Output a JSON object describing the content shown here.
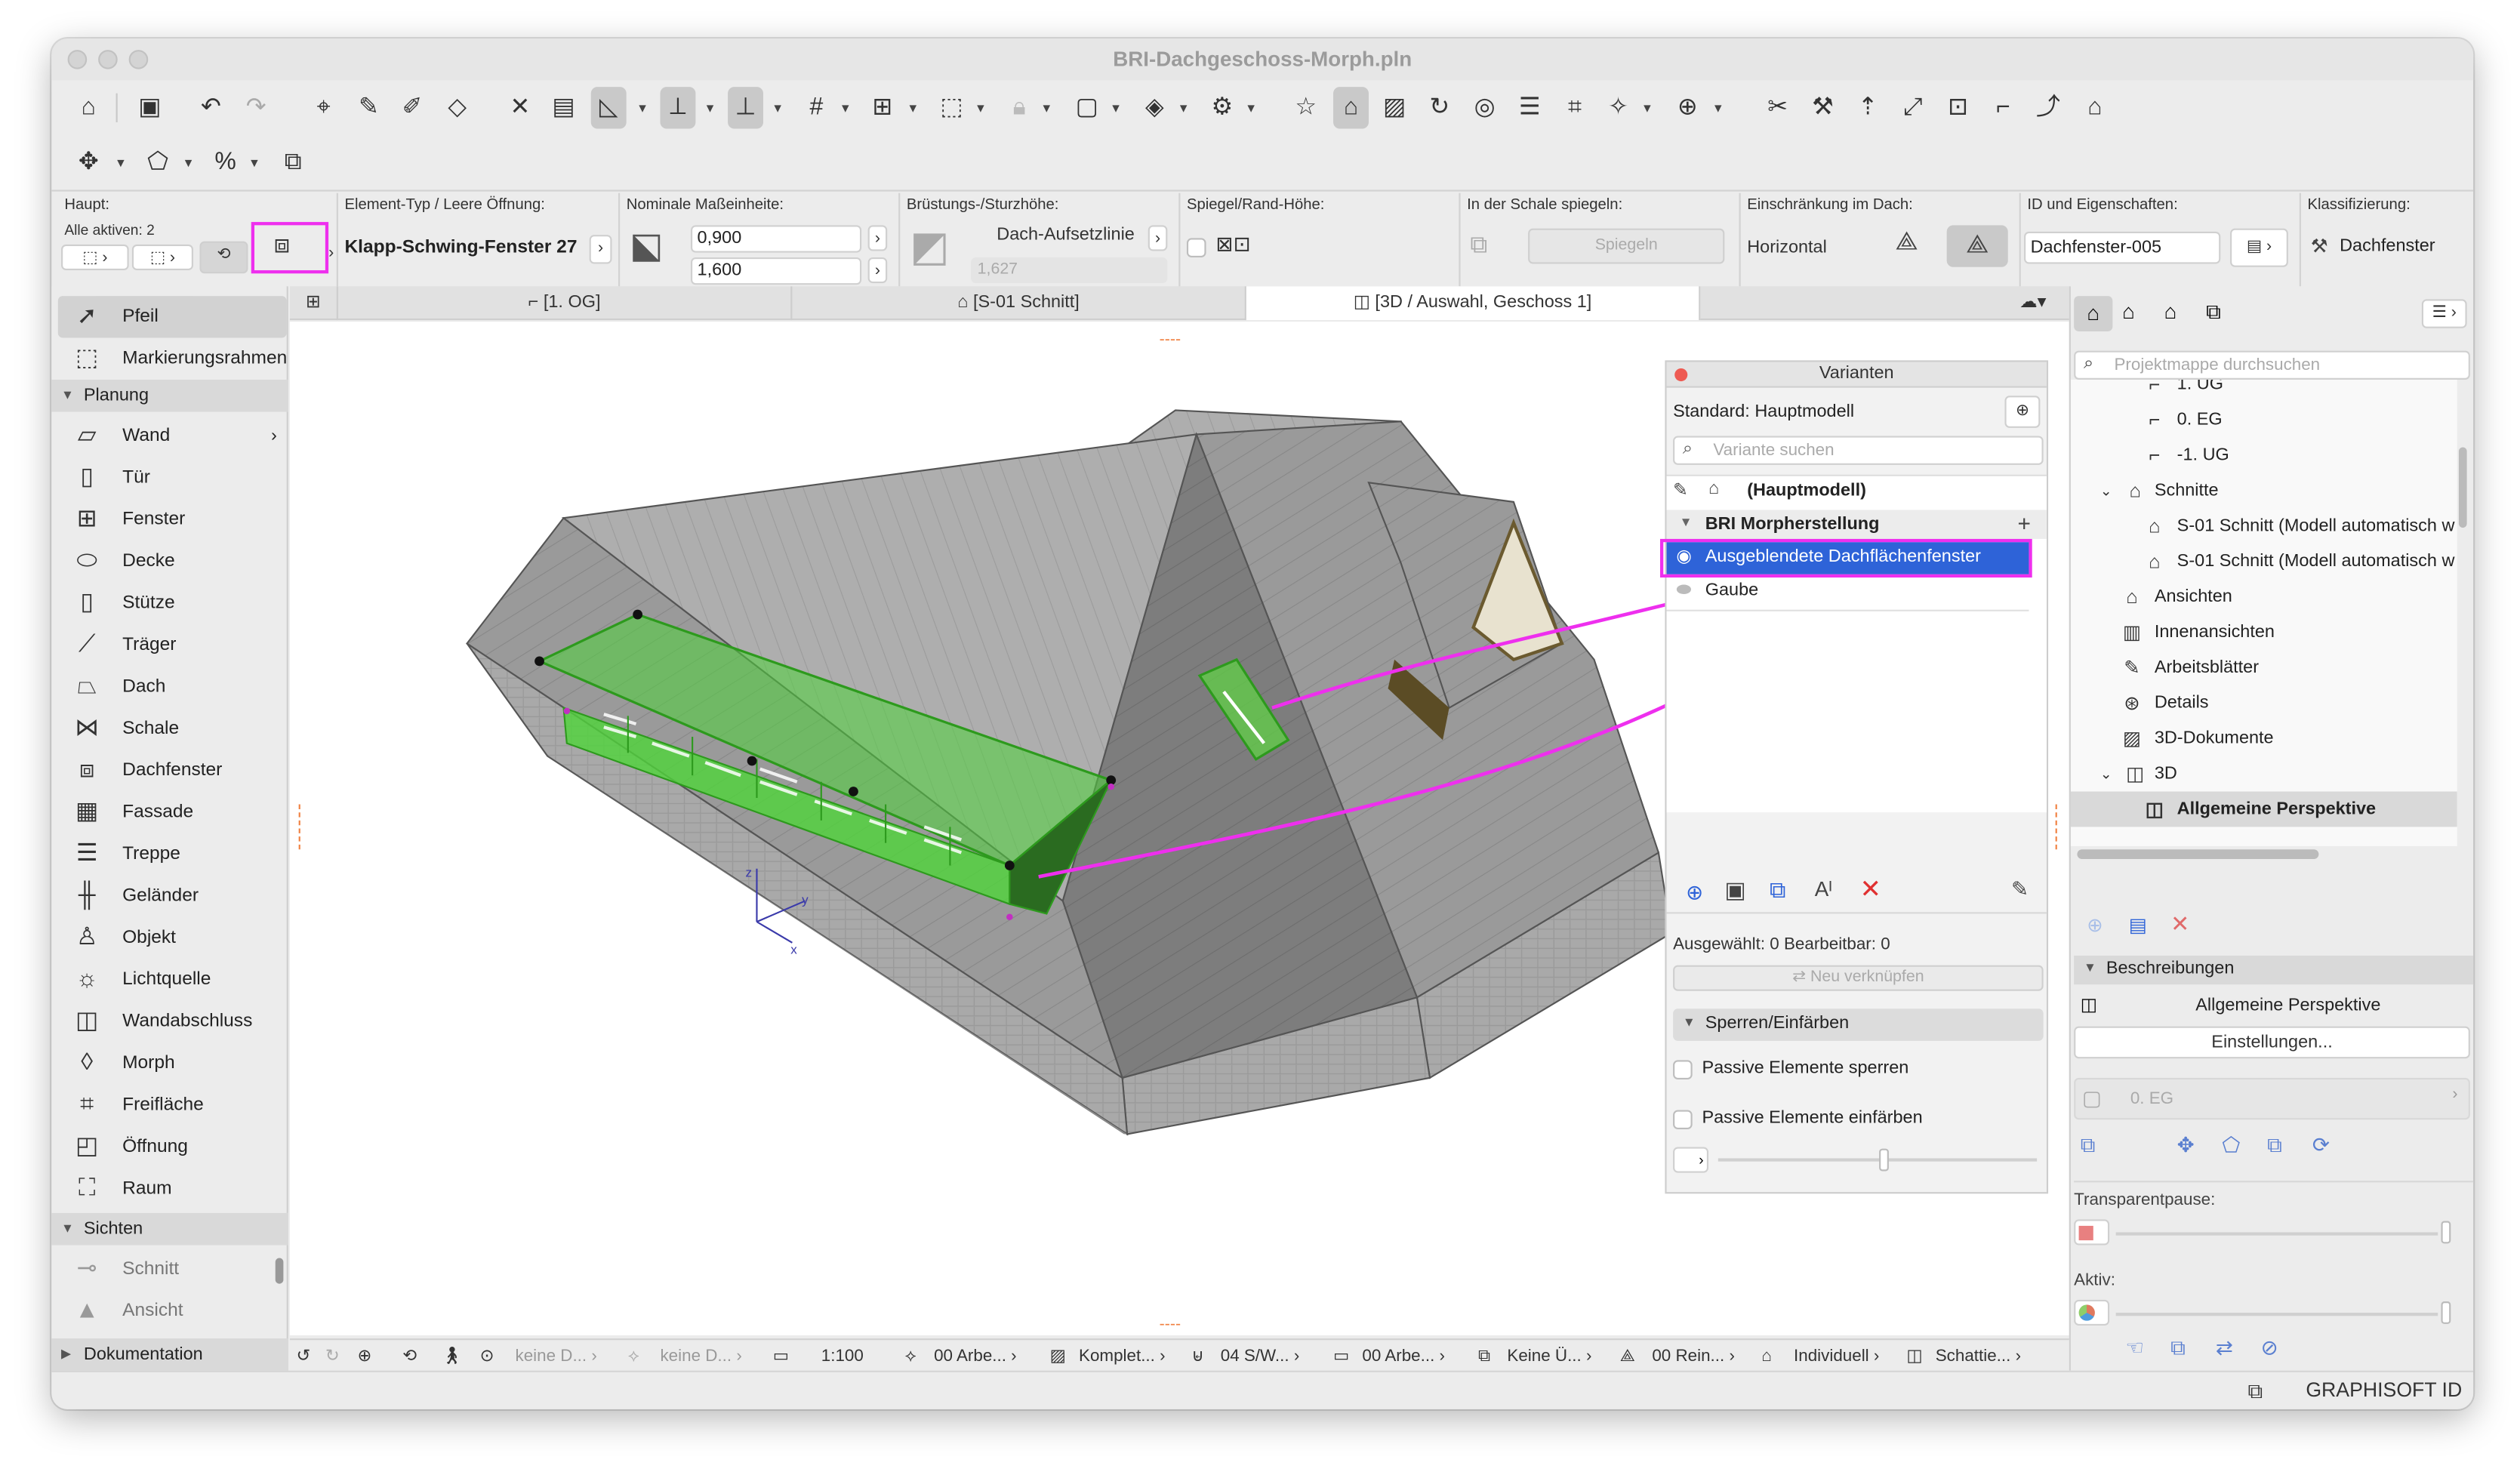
{
  "window": {
    "title": "BRI-Dachgeschoss-Morph.pln"
  },
  "info_box": {
    "haupt_label": "Haupt:",
    "alle_aktiven": "Alle aktiven: 2",
    "element_typ_label": "Element-Typ / Leere Öffnung:",
    "element_typ_value": "Klapp-Schwing-Fenster 27",
    "masseinheit_label": "Nominale Maßeinheite:",
    "width_value": "0,900",
    "height_value": "1,600",
    "bruestung_label": "Brüstungs-/Sturzhöhe:",
    "bruestung_value": "Dach-Aufsetzlinie",
    "bruestung_num": "1,627",
    "spiegel_label": "Spiegel/Rand-Höhe:",
    "schale_label": "In der Schale spiegeln:",
    "spiegeln_button": "Spiegeln",
    "einschraenkung_label": "Einschränkung im Dach:",
    "einschraenkung_value": "Horizontal",
    "id_label": "ID und Eigenschaften:",
    "id_value": "Dachfenster-005",
    "klass_label": "Klassifizierung:",
    "klass_value": "Dachfenster"
  },
  "toolbox": {
    "pfeil": "Pfeil",
    "markierungsrahmen": "Markierungsrahmen",
    "planung_header": "Planung",
    "planung_items": [
      "Wand",
      "Tür",
      "Fenster",
      "Decke",
      "Stütze",
      "Träger",
      "Dach",
      "Schale",
      "Dachfenster",
      "Fassade",
      "Treppe",
      "Geländer",
      "Objekt",
      "Lichtquelle",
      "Wandabschluss",
      "Morph",
      "Freifläche",
      "Öffnung",
      "Raum"
    ],
    "sichten_header": "Sichten",
    "sichten_items": [
      "Schnitt",
      "Ansicht"
    ],
    "dokumentation_header": "Dokumentation"
  },
  "tabs": [
    "[1. OG]",
    "[S-01 Schnitt]",
    "[3D / Auswahl, Geschoss 1]"
  ],
  "variants": {
    "title": "Varianten",
    "standard": "Standard: Hauptmodell",
    "search_placeholder": "Variante suchen",
    "hauptmodell": "(Hauptmodell)",
    "group": "BRI Morpherstellung",
    "selected": "Ausgeblendete Dachflächenfenster",
    "second": "Gaube",
    "ausgewaehlt": "Ausgewählt: 0 Bearbeitbar: 0",
    "neu_verknuepfen": "Neu verknüpfen",
    "sperren_header": "Sperren/Einfärben",
    "passive_sperren": "Passive Elemente sperren",
    "passive_einfaerben": "Passive Elemente einfärben"
  },
  "navigator": {
    "search_placeholder": "Projektmappe durchsuchen",
    "items": [
      "1. UG",
      "0. EG",
      "-1. UG",
      "Schnitte",
      "S-01 Schnitt (Modell automatisch w",
      "S-01 Schnitt (Modell automatisch w",
      "Ansichten",
      "Innenansichten",
      "Arbeitsblätter",
      "Details",
      "3D-Dokumente",
      "3D",
      "Allgemeine Perspektive"
    ],
    "beschreibungen": "Beschreibungen",
    "perspektive": "Allgemeine Perspektive",
    "einstellungen": "Einstellungen...",
    "geschoss": "0. EG",
    "transparentpause": "Transparentpause:",
    "aktiv": "Aktiv:"
  },
  "statusbar": {
    "keine_d1": "keine D...",
    "keine_d2": "keine D...",
    "scale": "1:100",
    "arbe1": "00 Arbe...",
    "komplet": "Komplet...",
    "sw": "04 S/W...",
    "arbe2": "00 Arbe...",
    "keine_u": "Keine Ü...",
    "rein": "00 Rein...",
    "individuell": "Individuell",
    "schatten": "Schattie..."
  },
  "bottom": {
    "brand": "GRAPHISOFT ID"
  },
  "colors": {
    "accent": "#2e63d8",
    "highlight": "#ee2fee",
    "selection_green": "#4fd43a"
  }
}
